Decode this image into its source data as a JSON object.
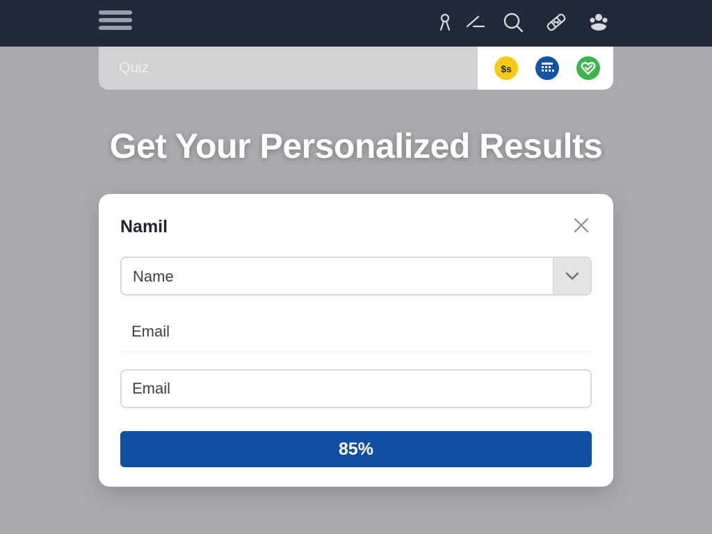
{
  "nav": {
    "icons": [
      "menu-icon",
      "profile-icon",
      "edit-icon",
      "search-icon",
      "bandage-icon",
      "community-icon"
    ]
  },
  "tabbar": {
    "tab_label": "Quiz",
    "badges": [
      {
        "icon": "coins-icon",
        "color": "#f6cb18"
      },
      {
        "icon": "calendar-grid-icon",
        "color": "#1253a3"
      },
      {
        "icon": "heart-check-icon",
        "color": "#3bb54a"
      }
    ]
  },
  "page": {
    "heading": "Get Your Personalized Results"
  },
  "modal": {
    "title": "Namil",
    "name_select": {
      "value": "Name"
    },
    "email_label": "Email",
    "email_input": {
      "placeholder": "Email",
      "value": ""
    },
    "progress": {
      "value": 0.85,
      "label": "85%"
    }
  },
  "colors": {
    "topbar": "#222938",
    "background": "#a8aaad",
    "primary": "#0f4ea1"
  }
}
